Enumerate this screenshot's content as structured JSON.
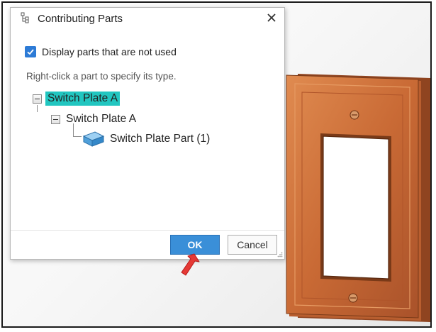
{
  "dialog": {
    "title": "Contributing Parts",
    "option_label": "Display parts that are not used",
    "option_checked": true,
    "hint": "Right-click a part to specify its type.",
    "tree": {
      "root": "Switch Plate A",
      "child": "Switch Plate A",
      "leaf": "Switch Plate Part (1)"
    },
    "ok_label": "OK",
    "cancel_label": "Cancel"
  },
  "icons": {
    "title": "assembly-tree-icon",
    "close": "close-icon",
    "check": "checkmark-icon",
    "part": "solid-part-icon",
    "pointer": "red-arrow-pointer-icon"
  },
  "colors": {
    "selection": "#21c6c0",
    "ok_button": "#3a8fd8",
    "checkbox": "#2d7bd6",
    "plate": "#c96a35",
    "arrow": "#e53935"
  }
}
